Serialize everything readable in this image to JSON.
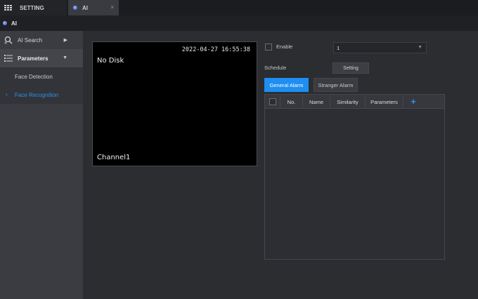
{
  "tabs": [
    {
      "label": "SETTING",
      "icon": "grid-icon"
    },
    {
      "label": "AI",
      "icon": "ai-dot-icon",
      "close": "×"
    }
  ],
  "page_title": "AI",
  "sidebar": {
    "items": [
      {
        "label": "AI Search",
        "icon": "ai-search-icon",
        "arrow": "▶"
      },
      {
        "label": "Parameters",
        "icon": "list-icon",
        "arrow": "▼"
      }
    ],
    "subitems": [
      {
        "label": "Face Detection"
      },
      {
        "label": "Face Recognition",
        "active": true,
        "chevron": "›"
      }
    ]
  },
  "preview": {
    "timestamp": "2022-04-27 16:55:38",
    "status": "No Disk",
    "channel": "Channel1"
  },
  "settings": {
    "enable_label": "Enable",
    "enable_checked": false,
    "channel_select_value": "1",
    "schedule_label": "Schedule",
    "setting_button": "Setting"
  },
  "alarm_tabs": {
    "general": "General Alarm",
    "stranger": "Stranger Alarm"
  },
  "table": {
    "columns": [
      "No.",
      "Name",
      "Similarity",
      "Parameters"
    ],
    "add": "+",
    "rows": []
  },
  "colors": {
    "accent": "#1e8ef2",
    "active_link": "#2e8fe6",
    "background": "#2b2d31",
    "sidebar": "#3a3c41"
  }
}
